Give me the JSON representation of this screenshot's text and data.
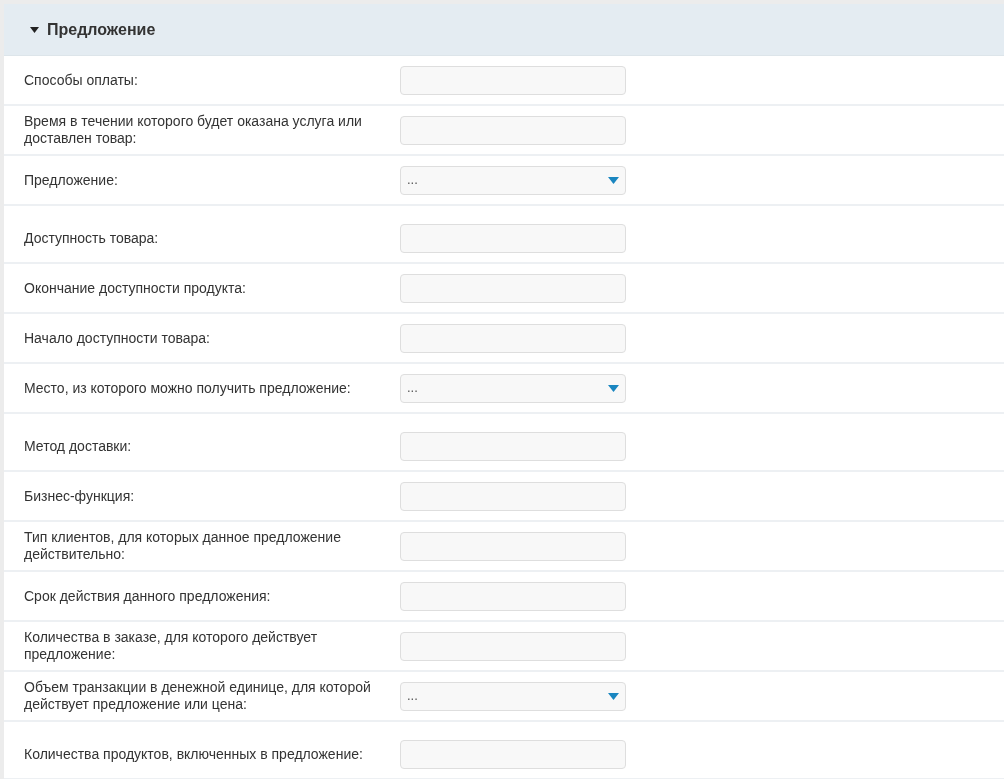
{
  "section": {
    "title": "Предложение",
    "expanded": true
  },
  "fields": [
    {
      "label": "Способы оплаты:",
      "kind": "text"
    },
    {
      "label": "Время в течении которого будет оказана услуга или доставлен товар:",
      "kind": "text"
    },
    {
      "label": "Предложение:",
      "kind": "select",
      "value": "..."
    },
    {
      "label": "Доступность товара:",
      "kind": "text"
    },
    {
      "label": "Окончание доступности продукта:",
      "kind": "text"
    },
    {
      "label": "Начало доступности товара:",
      "kind": "text"
    },
    {
      "label": "Место, из которого можно получить предложение:",
      "kind": "select",
      "value": "..."
    },
    {
      "label": "Метод доставки:",
      "kind": "text"
    },
    {
      "label": "Бизнес-функция:",
      "kind": "text"
    },
    {
      "label": "Тип клиентов, для которых данное предложение действительно:",
      "kind": "text"
    },
    {
      "label": "Срок действия данного предложения:",
      "kind": "text"
    },
    {
      "label": "Количества в заказе, для которого действует предложение:",
      "kind": "text"
    },
    {
      "label": "Объем транзакции в денежной единице, для которой действует предложение или цена:",
      "kind": "select",
      "value": "..."
    },
    {
      "label": "Количества продуктов, включенных в предложение:",
      "kind": "text"
    }
  ]
}
